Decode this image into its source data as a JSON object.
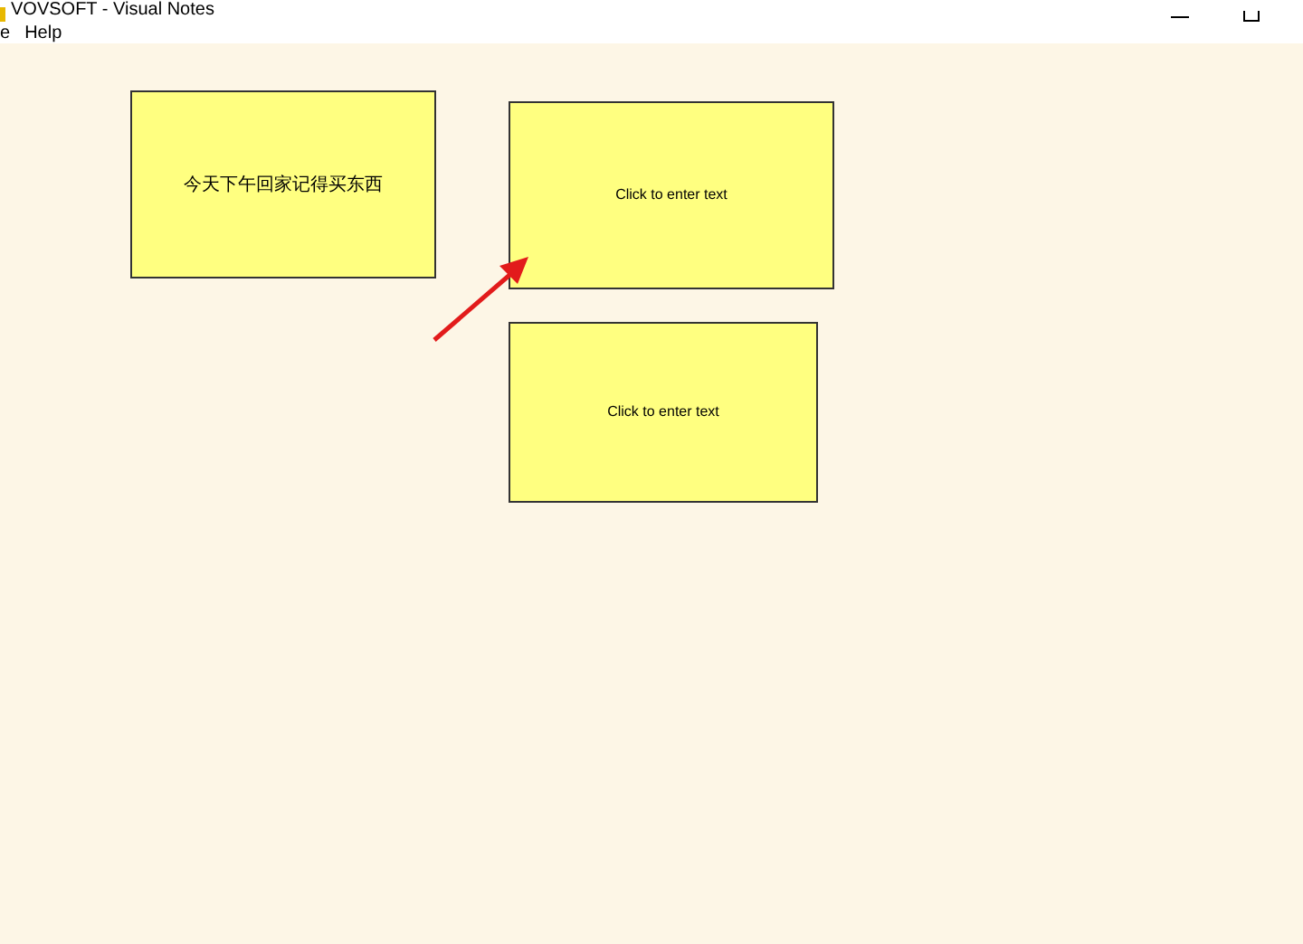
{
  "window": {
    "title": "VOVSOFT - Visual Notes"
  },
  "menu": [
    "e",
    "Help"
  ],
  "notes": [
    {
      "text": "今天下午回家记得买东西"
    },
    {
      "text": "Click to enter text"
    },
    {
      "text": "Click to enter text"
    }
  ]
}
